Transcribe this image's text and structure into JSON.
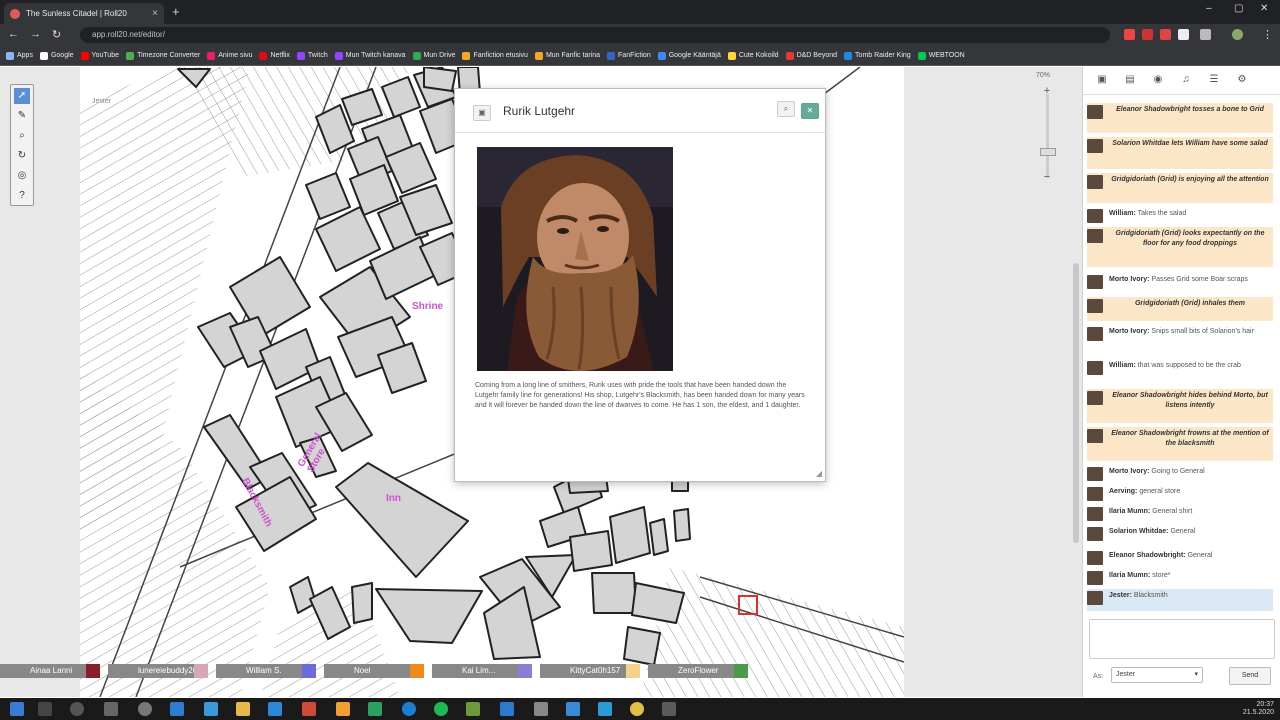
{
  "browser": {
    "tab_title": "The Sunless Citadel | Roll20",
    "url": "app.roll20.net/editor/",
    "bookmarks": [
      {
        "label": "Apps",
        "color": "#8ab4f8"
      },
      {
        "label": "Google",
        "color": "#ffffff"
      },
      {
        "label": "YouTube",
        "color": "#ff0000"
      },
      {
        "label": "Timezone Converter",
        "color": "#4caf50"
      },
      {
        "label": "Anime sivu",
        "color": "#e91e63"
      },
      {
        "label": "Netflix",
        "color": "#e50914"
      },
      {
        "label": "Twitch",
        "color": "#9146ff"
      },
      {
        "label": "Mun Twitch kanava",
        "color": "#9146ff"
      },
      {
        "label": "Mun Drive",
        "color": "#34a853"
      },
      {
        "label": "Fanfiction etusivu",
        "color": "#f5a623"
      },
      {
        "label": "Mun Fanfic tarina",
        "color": "#f5a623"
      },
      {
        "label": "FanFiction",
        "color": "#3366cc"
      },
      {
        "label": "Google Kääntäjä",
        "color": "#4285f4"
      },
      {
        "label": "Cute Kokoild",
        "color": "#fdd835"
      },
      {
        "label": "D&D Beyond",
        "color": "#e53935"
      },
      {
        "label": "Tomb Raider King",
        "color": "#1e88e5"
      },
      {
        "label": "WEBTOON",
        "color": "#00c853"
      }
    ]
  },
  "map": {
    "corner_note": "Jester",
    "labels": {
      "shrine": "Shrine",
      "general_store": "General Store",
      "blacksmith": "Blacksmith",
      "inn": "Inn"
    },
    "zoom": "70%"
  },
  "toolbar": {
    "tools": [
      {
        "icon": "select-icon",
        "glyph": "➚",
        "active": true
      },
      {
        "icon": "draw-icon",
        "glyph": "✎",
        "active": false
      },
      {
        "icon": "zoom-icon",
        "glyph": "⌕",
        "active": false
      },
      {
        "icon": "refresh-icon",
        "glyph": "↻",
        "active": false
      },
      {
        "icon": "gm-layer-icon",
        "glyph": "◎",
        "active": false
      },
      {
        "icon": "help-icon",
        "glyph": "?",
        "active": false
      }
    ]
  },
  "handout": {
    "title": "Rurik Lutgehr",
    "description": "Coming from a long line of smithers, Rurik uses with pride the tools that have been handed down the Lutgehr family line for generations! His shop, Lutgehr's Blacksmith, has been handed down for many years and it will forever be handed down the line of dwarves to come. He has 1 son, the eldest, and 1 daughter."
  },
  "players": [
    {
      "name": "Ainaa Lanni",
      "color": "#8a1c2b"
    },
    {
      "name": "lunereiebuddy2019",
      "color": "#d7a6b8"
    },
    {
      "name": "William S.",
      "color": "#6b6bdc"
    },
    {
      "name": "Noel",
      "color": "#f08a1c"
    },
    {
      "name": "Kai Lim...",
      "color": "#8a7fd6"
    },
    {
      "name": "KittyCat0h157",
      "color": "#f3d38a"
    },
    {
      "name": "ZeroFlower",
      "color": "#4b9a4b"
    }
  ],
  "chat": {
    "messages": [
      {
        "speaker": "",
        "text": "Eleanor Shadowbright tosses a bone to Grid",
        "emote": true
      },
      {
        "speaker": "",
        "text": "Solarion Whitdae lets William have some salad",
        "emote": true
      },
      {
        "speaker": "",
        "text": "Gridgidoriath (Grid) is enjoying all the attention",
        "emote": true
      },
      {
        "speaker": "William:",
        "text": "Takes the salad",
        "emote": false
      },
      {
        "speaker": "",
        "text": "Gridgidoriath (Grid) looks expectantly on the floor for any food droppings",
        "emote": true
      },
      {
        "speaker": "Morto Ivory:",
        "text": "Passes Grid some Boar scraps",
        "emote": false
      },
      {
        "speaker": "",
        "text": "Gridgidoriath (Grid) inhales them",
        "emote": true
      },
      {
        "speaker": "Morto Ivory:",
        "text": "Snips small bits of Solarion's hair",
        "emote": false
      },
      {
        "speaker": "William:",
        "text": "that was supposed to be the crab",
        "emote": false
      },
      {
        "speaker": "",
        "text": "Eleanor Shadowbright hides behind Morto, but listens intently",
        "emote": true
      },
      {
        "speaker": "",
        "text": "Eleanor Shadowbright frowns at the mention of the blacksmith",
        "emote": true
      },
      {
        "speaker": "Morto Ivory:",
        "text": "Going to General",
        "emote": false
      },
      {
        "speaker": "Aerving:",
        "text": "general store",
        "emote": false
      },
      {
        "speaker": "Ilaria Mumn:",
        "text": "General shirt",
        "emote": false
      },
      {
        "speaker": "Solarion Whitdae:",
        "text": "General",
        "emote": false
      },
      {
        "speaker": "Eleanor Shadowbright:",
        "text": "General",
        "emote": false
      },
      {
        "speaker": "Ilaria Mumn:",
        "text": "store*",
        "emote": false
      },
      {
        "speaker": "Jester:",
        "text": "Blacksmith",
        "emote": false
      }
    ],
    "as_label": "As:",
    "as_value": "Jester",
    "send_label": "Send"
  },
  "taskbar": {
    "time": "20:37",
    "date": "21.5.2020"
  }
}
